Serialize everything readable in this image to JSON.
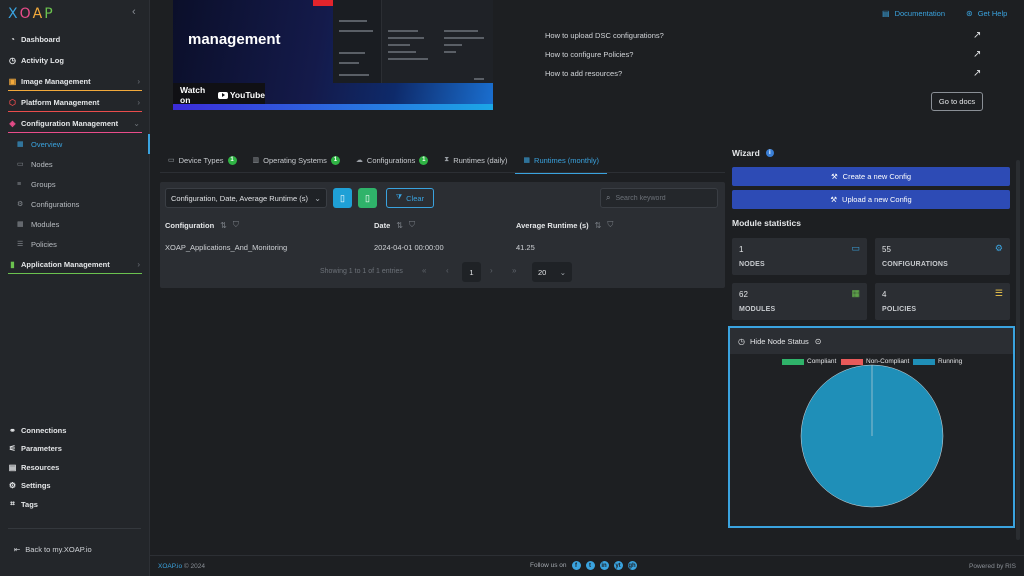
{
  "app": {
    "logo": "XOAP",
    "logo_colors": [
      "#3aa3df",
      "#e94c8a",
      "#f2a93b",
      "#6bc24f"
    ]
  },
  "sidebar": {
    "items": [
      {
        "label": "Dashboard",
        "icon": "speedometer-icon"
      },
      {
        "label": "Activity Log",
        "icon": "clock-icon"
      },
      {
        "label": "Image Management",
        "icon": "image-icon",
        "color": "#f2a93b"
      },
      {
        "label": "Platform Management",
        "icon": "hexagon-icon",
        "color": "#e94c4c"
      },
      {
        "label": "Configuration Management",
        "icon": "cube-icon",
        "color": "#e94c8a"
      },
      {
        "label": "Application Management",
        "icon": "chart-bar-icon",
        "color": "#6bc24f"
      }
    ],
    "sub_items": [
      "Overview",
      "Nodes",
      "Groups",
      "Configurations",
      "Modules",
      "Policies"
    ],
    "bottom_items": [
      "Connections",
      "Parameters",
      "Resources",
      "Settings",
      "Tags"
    ],
    "back_link": "Back to my.XOAP.io"
  },
  "topbar": {
    "documentation": "Documentation",
    "help": "Get Help"
  },
  "video": {
    "title": "management",
    "watch_label": "Watch on",
    "youtube_label": "YouTube"
  },
  "faq": {
    "items": [
      "How to upload DSC configurations?",
      "How to configure Policies?",
      "How to add resources?"
    ],
    "docs_button": "Go to docs"
  },
  "tabs": [
    {
      "label": "Device Types",
      "badge": "1"
    },
    {
      "label": "Operating Systems",
      "badge": "1"
    },
    {
      "label": "Configurations",
      "badge": "1"
    },
    {
      "label": "Runtimes (daily)",
      "badge": ""
    },
    {
      "label": "Runtimes (monthly)",
      "badge": ""
    }
  ],
  "table": {
    "column_select": "Configuration, Date, Average Runtime (s)",
    "clear_label": "Clear",
    "search_placeholder": "Search keyword",
    "columns": [
      "Configuration",
      "Date",
      "Average Runtime (s)"
    ],
    "rows": [
      [
        "XOAP_Applications_And_Monitoring",
        "2024-04-01 00:00:00",
        "41.25"
      ]
    ],
    "pager_info": "Showing 1 to 1 of 1 entries",
    "current_page": "1",
    "page_size": "20"
  },
  "wizard": {
    "title": "Wizard",
    "create_label": "Create a new Config",
    "upload_label": "Upload a new Config"
  },
  "module_stats": {
    "title": "Module statistics",
    "cards": [
      {
        "value": "1",
        "label": "NODES",
        "icon": "laptop-icon",
        "color": "#3aa3df"
      },
      {
        "value": "55",
        "label": "CONFIGURATIONS",
        "icon": "gear-icon",
        "color": "#3aa3df"
      },
      {
        "value": "62",
        "label": "MODULES",
        "icon": "grid-icon",
        "color": "#6bc24f"
      },
      {
        "value": "4",
        "label": "POLICIES",
        "icon": "list-icon",
        "color": "#f2c94c"
      }
    ]
  },
  "node_status": {
    "toggle_label": "Hide Node Status"
  },
  "chart_data": {
    "type": "pie",
    "series": [
      {
        "name": "Compliant",
        "value": 0,
        "color": "#2fb36a"
      },
      {
        "name": "Non-Compliant",
        "value": 0,
        "color": "#e85a5a"
      },
      {
        "name": "Running",
        "value": 1,
        "color": "#1f8fb8"
      }
    ],
    "legend_position": "top"
  },
  "footer": {
    "brand": "XOAP.io",
    "copyright": "© 2024",
    "follow": "Follow us on",
    "socials": [
      "f",
      "t",
      "in",
      "yt",
      "gh"
    ],
    "powered": "Powered by RIS"
  }
}
